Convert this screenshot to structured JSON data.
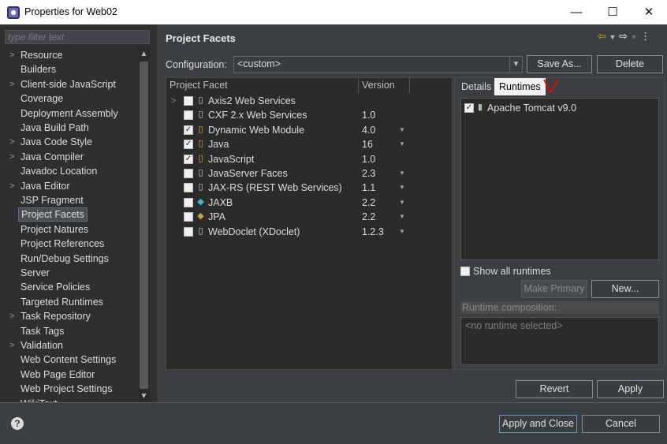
{
  "window": {
    "title": "Properties for Web02",
    "minimize_glyph": "—",
    "maximize_glyph": "☐",
    "close_glyph": "✕"
  },
  "filter": {
    "placeholder": "type filter text"
  },
  "nav_items": [
    {
      "label": "Resource",
      "arrow": true
    },
    {
      "label": "Builders",
      "arrow": false
    },
    {
      "label": "Client-side JavaScript",
      "arrow": true
    },
    {
      "label": "Coverage",
      "arrow": false
    },
    {
      "label": "Deployment Assembly",
      "arrow": false
    },
    {
      "label": "Java Build Path",
      "arrow": false
    },
    {
      "label": "Java Code Style",
      "arrow": true
    },
    {
      "label": "Java Compiler",
      "arrow": true
    },
    {
      "label": "Javadoc Location",
      "arrow": false
    },
    {
      "label": "Java Editor",
      "arrow": true
    },
    {
      "label": "JSP Fragment",
      "arrow": false
    },
    {
      "label": "Project Facets",
      "arrow": false,
      "selected": true
    },
    {
      "label": "Project Natures",
      "arrow": false
    },
    {
      "label": "Project References",
      "arrow": false
    },
    {
      "label": "Run/Debug Settings",
      "arrow": false
    },
    {
      "label": "Server",
      "arrow": false
    },
    {
      "label": "Service Policies",
      "arrow": false
    },
    {
      "label": "Targeted Runtimes",
      "arrow": false
    },
    {
      "label": "Task Repository",
      "arrow": true
    },
    {
      "label": "Task Tags",
      "arrow": false
    },
    {
      "label": "Validation",
      "arrow": true
    },
    {
      "label": "Web Content Settings",
      "arrow": false
    },
    {
      "label": "Web Page Editor",
      "arrow": false
    },
    {
      "label": "Web Project Settings",
      "arrow": false
    },
    {
      "label": "WikiText",
      "arrow": false
    }
  ],
  "page": {
    "heading": "Project Facets",
    "config_label": "Configuration:",
    "config_value": "<custom>",
    "save_as": "Save As...",
    "delete": "Delete"
  },
  "facets": {
    "col_facet": "Project Facet",
    "col_version": "Version",
    "rows": [
      {
        "name": "Axis2 Web Services",
        "version": "",
        "checked": false,
        "expandable": true,
        "icon": "page-icon",
        "dropdown": false
      },
      {
        "name": "CXF 2.x Web Services",
        "version": "1.0",
        "checked": false,
        "expandable": false,
        "icon": "page-icon",
        "dropdown": false
      },
      {
        "name": "Dynamic Web Module",
        "version": "4.0",
        "checked": true,
        "expandable": false,
        "icon": "lock-page-icon",
        "dropdown": true
      },
      {
        "name": "Java",
        "version": "16",
        "checked": true,
        "expandable": false,
        "icon": "lock-page-icon",
        "dropdown": true
      },
      {
        "name": "JavaScript",
        "version": "1.0",
        "checked": true,
        "expandable": false,
        "icon": "lock-page-icon",
        "dropdown": false
      },
      {
        "name": "JavaServer Faces",
        "version": "2.3",
        "checked": false,
        "expandable": false,
        "icon": "page-icon",
        "dropdown": true
      },
      {
        "name": "JAX-RS (REST Web Services)",
        "version": "1.1",
        "checked": false,
        "expandable": false,
        "icon": "page-icon",
        "dropdown": true
      },
      {
        "name": "JAXB",
        "version": "2.2",
        "checked": false,
        "expandable": false,
        "icon": "jaxb-icon",
        "dropdown": true
      },
      {
        "name": "JPA",
        "version": "2.2",
        "checked": false,
        "expandable": false,
        "icon": "jpa-icon",
        "dropdown": true
      },
      {
        "name": "WebDoclet (XDoclet)",
        "version": "1.2.3",
        "checked": false,
        "expandable": false,
        "icon": "page-icon",
        "dropdown": true
      }
    ]
  },
  "tabs": {
    "details": "Details",
    "runtimes": "Runtimes"
  },
  "runtimes": {
    "items": [
      {
        "name": "Apache Tomcat v9.0",
        "checked": true
      }
    ],
    "show_all": "Show all runtimes",
    "make_primary": "Make Primary",
    "new": "New...",
    "composition_label": "Runtime composition:",
    "composition_empty": "<no runtime selected>"
  },
  "buttons": {
    "revert": "Revert",
    "apply": "Apply",
    "apply_close": "Apply and Close",
    "cancel": "Cancel"
  },
  "colors": {
    "background": "#3c3f41",
    "panel": "#2b2b2b",
    "annotation": "#ff0000"
  }
}
